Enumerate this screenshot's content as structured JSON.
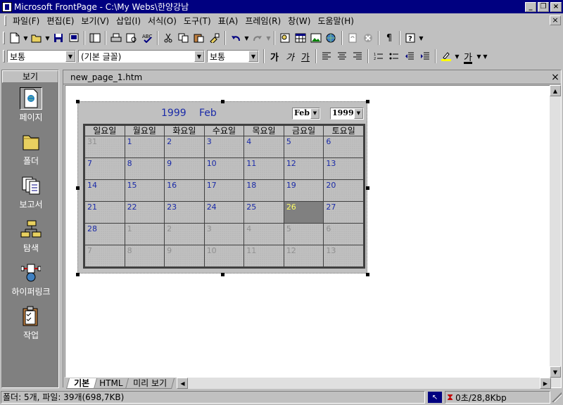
{
  "window": {
    "title": "Microsoft FrontPage - C:\\My Webs\\한양강남",
    "minimize": "_",
    "restore": "❐",
    "close": "×"
  },
  "menu": {
    "items": [
      "파일(F)",
      "편집(E)",
      "보기(V)",
      "삽입(I)",
      "서식(O)",
      "도구(T)",
      "표(A)",
      "프레임(R)",
      "창(W)",
      "도움말(H)"
    ],
    "close": "×"
  },
  "format_toolbar": {
    "style_value": "보통",
    "font_value": "(기본 글꼴)",
    "size_value": "보통",
    "bold": "가",
    "italic": "가",
    "underline": "가",
    "font_color": "가"
  },
  "views": {
    "header": "보기",
    "items": [
      {
        "label": "페이지",
        "icon": "page-view-icon"
      },
      {
        "label": "폴더",
        "icon": "folder-view-icon"
      },
      {
        "label": "보고서",
        "icon": "reports-view-icon"
      },
      {
        "label": "탐색",
        "icon": "navigation-view-icon"
      },
      {
        "label": "하이퍼링크",
        "icon": "hyperlinks-view-icon"
      },
      {
        "label": "작업",
        "icon": "tasks-view-icon"
      }
    ]
  },
  "document": {
    "tab_label": "new_page_1.htm",
    "close": "×"
  },
  "calendar": {
    "year": "1999",
    "month": "Feb",
    "month_select": "Feb",
    "year_select": "1999",
    "weekdays": [
      "일요일",
      "월요일",
      "화요일",
      "수요일",
      "목요일",
      "금요일",
      "토요일"
    ],
    "weeks": [
      [
        {
          "d": "31",
          "t": "other"
        },
        {
          "d": "1",
          "t": "cur"
        },
        {
          "d": "2",
          "t": "cur"
        },
        {
          "d": "3",
          "t": "cur"
        },
        {
          "d": "4",
          "t": "cur"
        },
        {
          "d": "5",
          "t": "cur"
        },
        {
          "d": "6",
          "t": "cur"
        }
      ],
      [
        {
          "d": "7",
          "t": "cur"
        },
        {
          "d": "8",
          "t": "cur"
        },
        {
          "d": "9",
          "t": "cur"
        },
        {
          "d": "10",
          "t": "cur"
        },
        {
          "d": "11",
          "t": "cur"
        },
        {
          "d": "12",
          "t": "cur"
        },
        {
          "d": "13",
          "t": "cur"
        }
      ],
      [
        {
          "d": "14",
          "t": "cur"
        },
        {
          "d": "15",
          "t": "cur"
        },
        {
          "d": "16",
          "t": "cur"
        },
        {
          "d": "17",
          "t": "cur"
        },
        {
          "d": "18",
          "t": "cur"
        },
        {
          "d": "19",
          "t": "cur"
        },
        {
          "d": "20",
          "t": "cur"
        }
      ],
      [
        {
          "d": "21",
          "t": "cur"
        },
        {
          "d": "22",
          "t": "cur"
        },
        {
          "d": "23",
          "t": "cur"
        },
        {
          "d": "24",
          "t": "cur"
        },
        {
          "d": "25",
          "t": "cur"
        },
        {
          "d": "26",
          "t": "today"
        },
        {
          "d": "27",
          "t": "cur"
        }
      ],
      [
        {
          "d": "28",
          "t": "cur"
        },
        {
          "d": "1",
          "t": "other"
        },
        {
          "d": "2",
          "t": "other"
        },
        {
          "d": "3",
          "t": "other"
        },
        {
          "d": "4",
          "t": "other"
        },
        {
          "d": "5",
          "t": "other"
        },
        {
          "d": "6",
          "t": "other"
        }
      ],
      [
        {
          "d": "7",
          "t": "other"
        },
        {
          "d": "8",
          "t": "other"
        },
        {
          "d": "9",
          "t": "other"
        },
        {
          "d": "10",
          "t": "other"
        },
        {
          "d": "11",
          "t": "other"
        },
        {
          "d": "12",
          "t": "other"
        },
        {
          "d": "13",
          "t": "other"
        }
      ]
    ]
  },
  "view_tabs": [
    "기본",
    "HTML",
    "미리 보기"
  ],
  "status": {
    "text": "폴더: 5개, 파일: 39개(698,7KB)",
    "speed": "0초/28,8Kbp"
  },
  "colors": {
    "titlebar": "#000080",
    "calendar_text": "#1a2aa8",
    "today_text": "#ffff66",
    "today_bg": "#808080"
  }
}
